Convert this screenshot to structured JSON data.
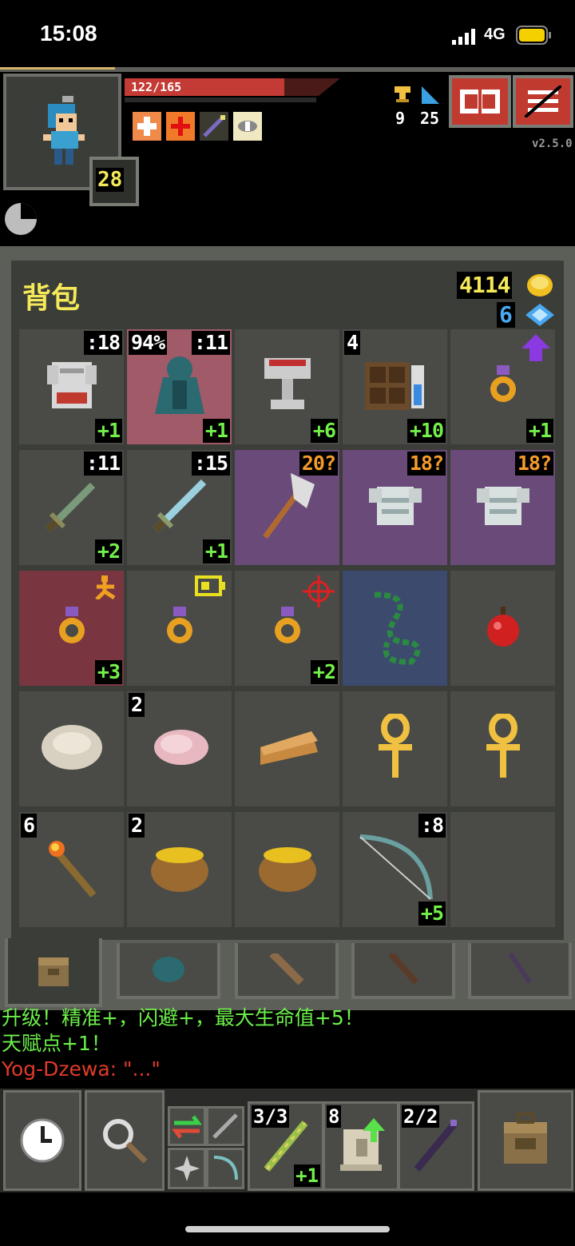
{
  "status_bar": {
    "time": "15:08",
    "network": "4G"
  },
  "hero": {
    "hp_text": "122/165",
    "hp_fraction": 0.74,
    "level": "28"
  },
  "hud": {
    "version": "v2.5.0",
    "depth_value": "9",
    "gold_icon_stat": "25"
  },
  "buffs": [
    "heal-buff-icon",
    "cross-buff-icon",
    "staff-buff-icon",
    "eye-buff-icon"
  ],
  "inventory": {
    "title": "背包",
    "gold": "4114",
    "energy": "6",
    "slots": [
      {
        "name": "slot-plate-armor",
        "icon": "plate-armor-icon",
        "tr": ":18",
        "br": "+1",
        "bg": "#4a4b46"
      },
      {
        "name": "slot-cloak",
        "icon": "cloak-icon",
        "tl": "94%",
        "tr": ":11",
        "br": "+1",
        "bg": "#a05a68"
      },
      {
        "name": "slot-chalice",
        "icon": "chalice-icon",
        "br": "+6",
        "bg": "#4a4b46"
      },
      {
        "name": "slot-spellbook",
        "icon": "alchemy-book-icon",
        "tl": "4",
        "br": "+10",
        "bg": "#4a4b46"
      },
      {
        "name": "slot-ring-upgrade",
        "icon": "ring-icon",
        "br": "+1",
        "bg": "#4a4b46",
        "badge": "upgrade-arrow-icon"
      },
      {
        "name": "slot-short-sword",
        "icon": "short-sword-icon",
        "tr": ":11",
        "br": "+2",
        "bg": "#4a4b46"
      },
      {
        "name": "slot-sword",
        "icon": "sword-icon",
        "tr": ":15",
        "br": "+1",
        "bg": "#4a4b46"
      },
      {
        "name": "slot-axe",
        "icon": "axe-icon",
        "tro": "20?",
        "bg": "#6a4a78"
      },
      {
        "name": "slot-mail-armor-1",
        "icon": "mail-armor-icon",
        "tro": "18?",
        "bg": "#6a4a78"
      },
      {
        "name": "slot-mail-armor-2",
        "icon": "mail-armor-icon",
        "tro": "18?",
        "bg": "#6a4a78"
      },
      {
        "name": "slot-ring-speed",
        "icon": "ring-icon",
        "br": "+3",
        "bg": "#7a3640",
        "badge": "runner-icon"
      },
      {
        "name": "slot-ring-energy",
        "icon": "ring-icon",
        "bg": "#4a4b46",
        "badge": "battery-icon"
      },
      {
        "name": "slot-ring-accuracy",
        "icon": "ring-icon",
        "br": "+2",
        "bg": "#4a4b46",
        "badge": "crosshair-icon"
      },
      {
        "name": "slot-chain",
        "icon": "chain-icon",
        "bg": "#3c4a6e"
      },
      {
        "name": "slot-apple",
        "icon": "apple-icon",
        "bg": "#4a4b46"
      },
      {
        "name": "slot-stone",
        "icon": "stone-icon",
        "bg": "#4a4b46"
      },
      {
        "name": "slot-meat",
        "icon": "meat-icon",
        "tl": "2",
        "bg": "#4a4b46"
      },
      {
        "name": "slot-pie",
        "icon": "pie-icon",
        "bg": "#4a4b46"
      },
      {
        "name": "slot-ankh-1",
        "icon": "ankh-icon",
        "bg": "#4a4b46"
      },
      {
        "name": "slot-ankh-2",
        "icon": "ankh-icon",
        "bg": "#4a4b46"
      },
      {
        "name": "slot-torch",
        "icon": "torch-icon",
        "tl": "6",
        "bg": "#4a4b46"
      },
      {
        "name": "slot-honey-pot",
        "icon": "honey-pot-icon",
        "tl": "2",
        "bg": "#4a4b46"
      },
      {
        "name": "slot-honey-pot-2",
        "icon": "honey-pot-icon",
        "bg": "#4a4b46"
      },
      {
        "name": "slot-bow",
        "icon": "bow-icon",
        "tr": ":8",
        "br": "+5",
        "bg": "#4a4b46"
      },
      {
        "name": "slot-empty",
        "icon": "",
        "bg": "#4a4b46"
      }
    ]
  },
  "messages": [
    {
      "text": "升级！精准+，闪避+，最大生命值+5！",
      "color": "#6cf04a"
    },
    {
      "text": "天赋点+1！",
      "color": "#6cf04a"
    },
    {
      "text": "Yog-Dzewa: \"...\"",
      "color": "#e23a2a"
    }
  ],
  "quickslots": [
    {
      "icon": "wand-icon",
      "tl": "3/3",
      "br": "+1"
    },
    {
      "icon": "scroll-icon",
      "tl": "8"
    },
    {
      "icon": "staff-icon",
      "tl": "2/2"
    }
  ],
  "colors": {
    "panel": "#3b3d38",
    "slot": "#4a4b46",
    "gold": "#f5e95a",
    "plus": "#74f04a",
    "unknown": "#f59b2a"
  }
}
